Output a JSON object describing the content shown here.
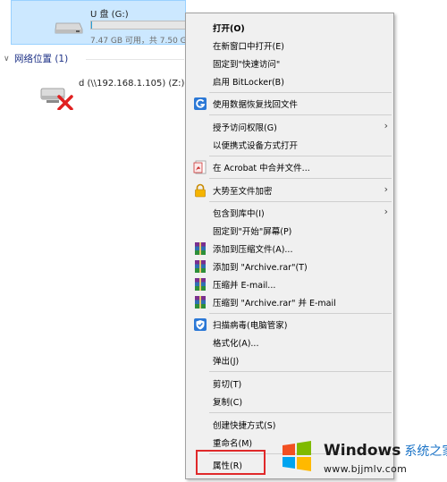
{
  "drive_usb": {
    "name": "U 盘 (G:)",
    "size_text": "7.47 GB 可用，共 7.50 GB",
    "used_fraction": 0.004,
    "icon": "usb-drive-icon"
  },
  "network_group": {
    "title": "网络位置 (1)",
    "icon": "chevron-down-icon"
  },
  "network_drive": {
    "name": "d (\\\\192.168.1.105) (Z:)",
    "icon": "disconnected-network-drive-icon"
  },
  "context_menu": {
    "items": [
      {
        "label": "打开(O)",
        "bold": true
      },
      {
        "label": "在新窗口中打开(E)"
      },
      {
        "label": "固定到\"快速访问\""
      },
      {
        "label": "启用 BitLocker(B)"
      },
      {
        "label": "使用数据恢复找回文件",
        "icon": "data-recovery-icon"
      },
      {
        "label": "授予访问权限(G)",
        "submenu": true
      },
      {
        "label": "以便携式设备方式打开"
      },
      {
        "label": "在 Acrobat 中合并文件...",
        "icon": "acrobat-icon"
      },
      {
        "label": "大势至文件加密",
        "icon": "lock-icon",
        "submenu": true
      },
      {
        "label": "包含到库中(I)",
        "submenu": true
      },
      {
        "label": "固定到\"开始\"屏幕(P)"
      },
      {
        "label": "添加到压缩文件(A)...",
        "icon": "winrar-icon"
      },
      {
        "label": "添加到 \"Archive.rar\"(T)",
        "icon": "winrar-icon"
      },
      {
        "label": "压缩并 E-mail...",
        "icon": "winrar-icon"
      },
      {
        "label": "压缩到 \"Archive.rar\" 并 E-mail",
        "icon": "winrar-icon"
      },
      {
        "label": "扫描病毒(电脑管家)",
        "icon": "shield-icon"
      },
      {
        "label": "格式化(A)..."
      },
      {
        "label": "弹出(J)"
      },
      {
        "label": "剪切(T)"
      },
      {
        "label": "复制(C)"
      },
      {
        "label": "创建快捷方式(S)"
      },
      {
        "label": "重命名(M)"
      },
      {
        "label": "属性(R)",
        "highlighted": true
      }
    ],
    "submenu_arrow": "›"
  },
  "watermark": {
    "title": "Windows",
    "title_cn": "系统之家",
    "url": "www.bjjmlv.com",
    "icon": "windows-logo-icon"
  },
  "colors": {
    "selection": "#cce8ff",
    "menu_bg": "#f0f0f0",
    "highlight_border": "#e0292a",
    "group_header": "#1e3287"
  }
}
